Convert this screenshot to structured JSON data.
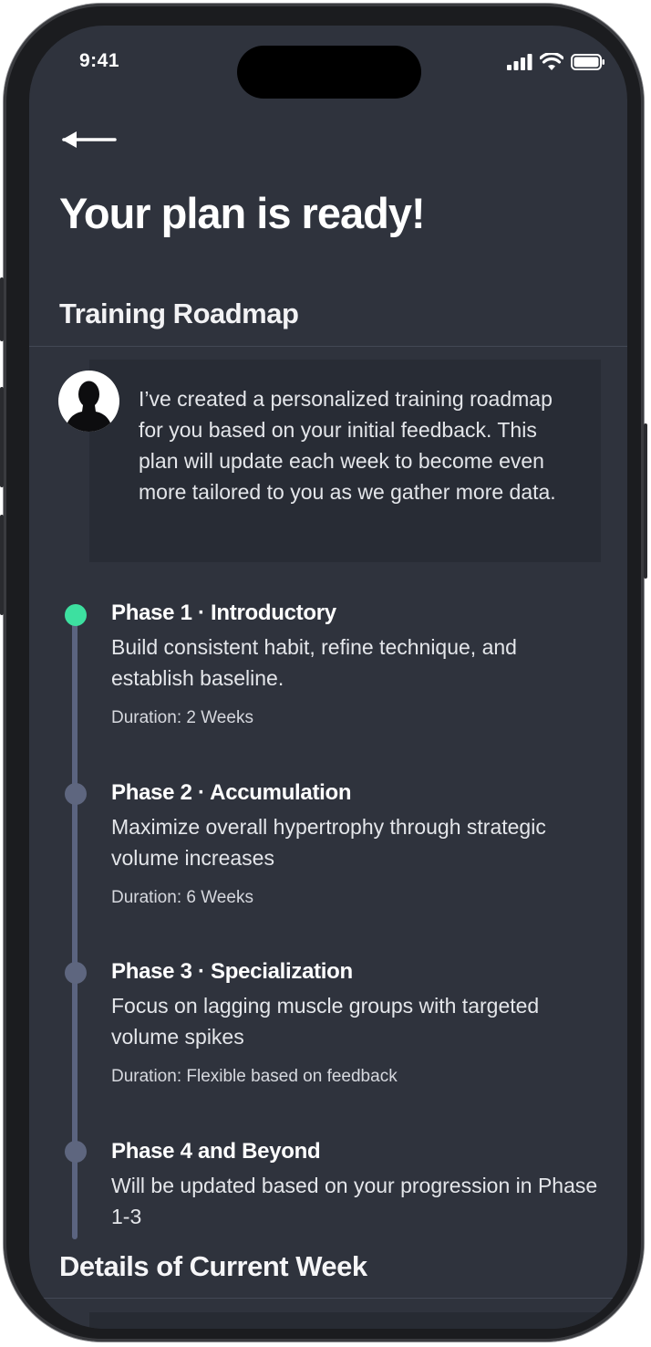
{
  "status_bar": {
    "time": "9:41"
  },
  "header": {
    "title": "Your plan is ready!"
  },
  "roadmap": {
    "section_title": "Training Roadmap",
    "message": "I’ve created a personalized training roadmap for you based on your initial feedback. This plan will update each week to become even more tailored to you as we gather more data.",
    "phases": [
      {
        "title": "Phase 1 · Introductory",
        "description": "Build consistent habit, refine technique, and establish baseline.",
        "duration": "Duration: 2 Weeks",
        "active": true
      },
      {
        "title": "Phase 2 · Accumulation",
        "description": "Maximize overall hypertrophy through strategic volume increases",
        "duration": "Duration: 6 Weeks",
        "active": false
      },
      {
        "title": "Phase 3 · Specialization",
        "description": "Focus on lagging muscle groups with targeted volume spikes",
        "duration": "Duration: Flexible based on feedback",
        "active": false
      },
      {
        "title": "Phase 4 and Beyond",
        "description": "Will be updated based on your progression in Phase 1-3",
        "active": false
      }
    ]
  },
  "current_week": {
    "section_title": "Details of Current Week"
  },
  "colors": {
    "background": "#2f333d",
    "active_dot": "#3de0a0",
    "inactive_dot": "#5e667f",
    "card": "#282c35"
  },
  "icons": {
    "back": "arrow-left-icon",
    "signal": "cellular-signal-icon",
    "wifi": "wifi-icon",
    "battery": "battery-icon",
    "avatar": "user-silhouette-icon"
  }
}
